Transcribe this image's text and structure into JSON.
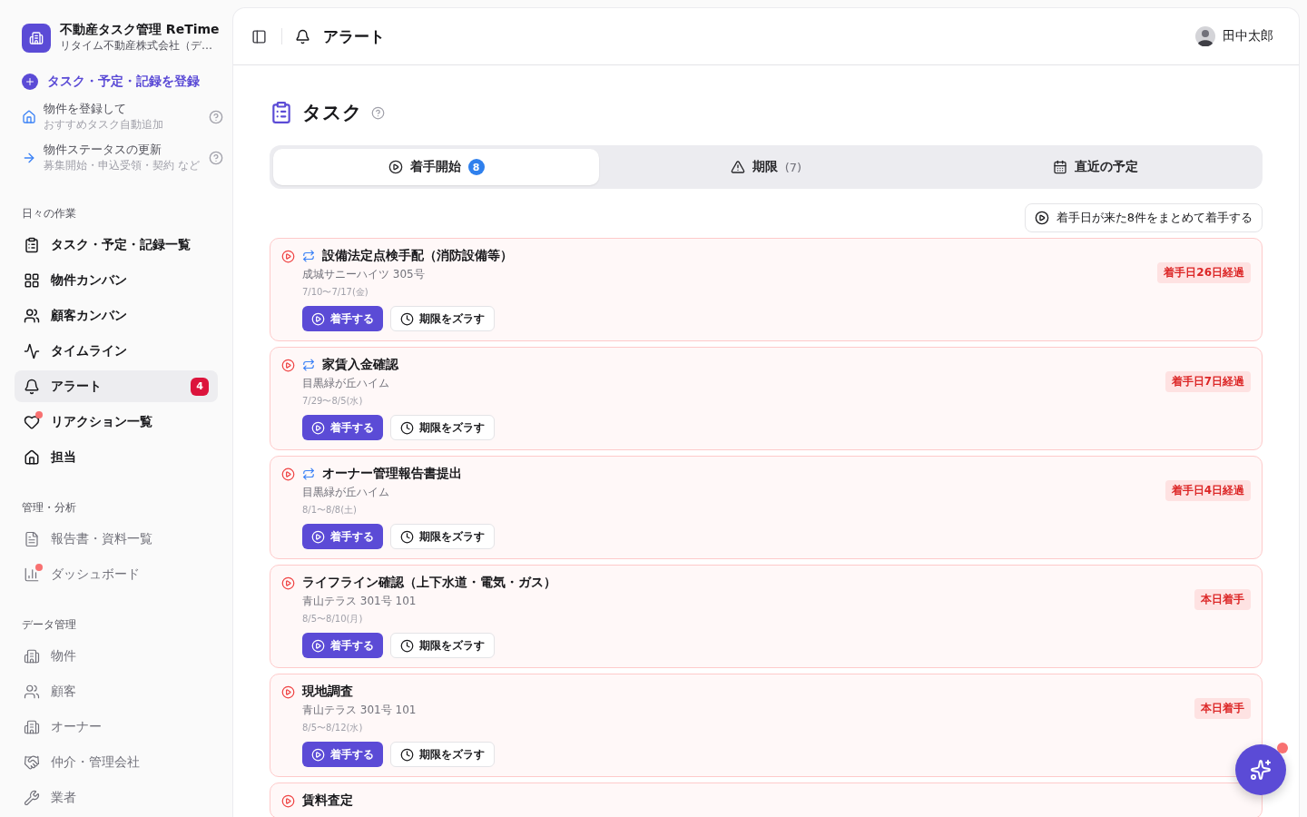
{
  "app": {
    "title": "不動産タスク管理 ReTime",
    "company": "リタイム不動産株式会社（デ…"
  },
  "register_link": {
    "label": "タスク・予定・記録を登録"
  },
  "helpers": [
    {
      "title": "物件を登録して",
      "subtitle": "おすすめタスク自動追加"
    },
    {
      "title": "物件ステータスの更新",
      "subtitle": "募集開始・申込受領・契約 など"
    }
  ],
  "sidebar": {
    "sections": [
      {
        "heading": "日々の作業",
        "kind": "primary",
        "items": [
          {
            "label": "タスク・予定・記録一覧",
            "selected": false,
            "dot": false
          },
          {
            "label": "物件カンバン",
            "selected": false,
            "dot": false
          },
          {
            "label": "顧客カンバン",
            "selected": false,
            "dot": false
          },
          {
            "label": "タイムライン",
            "selected": false,
            "dot": false
          },
          {
            "label": "アラート",
            "selected": true,
            "dot": false,
            "badge": "4"
          },
          {
            "label": "リアクション一覧",
            "selected": false,
            "dot": true
          },
          {
            "label": "担当",
            "selected": false,
            "dot": false
          }
        ]
      },
      {
        "heading": "管理・分析",
        "kind": "secondary",
        "items": [
          {
            "label": "報告書・資料一覧",
            "selected": false,
            "dot": false
          },
          {
            "label": "ダッシュボード",
            "selected": false,
            "dot": true
          }
        ]
      },
      {
        "heading": "データ管理",
        "kind": "secondary",
        "items": [
          {
            "label": "物件",
            "selected": false,
            "dot": false
          },
          {
            "label": "顧客",
            "selected": false,
            "dot": false
          },
          {
            "label": "オーナー",
            "selected": false,
            "dot": false
          },
          {
            "label": "仲介・管理会社",
            "selected": false,
            "dot": false
          },
          {
            "label": "業者",
            "selected": false,
            "dot": false
          }
        ]
      }
    ]
  },
  "header": {
    "title": "アラート",
    "user": "田中太郎"
  },
  "page": {
    "title": "タスク"
  },
  "tabs": [
    {
      "label": "着手開始",
      "count": "8",
      "selected": true
    },
    {
      "label": "期限",
      "count": "(7)",
      "selected": false
    },
    {
      "label": "直近の予定",
      "selected": false
    }
  ],
  "bulk_button": "着手日が来た8件をまとめて着手する",
  "tasks": [
    {
      "title": "設備法定点検手配（消防設備等）",
      "recurring": true,
      "property": "成城サニーハイツ 305号",
      "dates": "7/10〜7/17(金)",
      "status": "着手日26日経過",
      "start_label": "着手する",
      "postpone_label": "期限をズラす"
    },
    {
      "title": "家賃入金確認",
      "recurring": true,
      "property": "目黒緑が丘ハイム",
      "dates": "7/29〜8/5(水)",
      "status": "着手日7日経過",
      "start_label": "着手する",
      "postpone_label": "期限をズラす"
    },
    {
      "title": "オーナー管理報告書提出",
      "recurring": true,
      "property": "目黒緑が丘ハイム",
      "dates": "8/1〜8/8(土)",
      "status": "着手日4日経過",
      "start_label": "着手する",
      "postpone_label": "期限をズラす"
    },
    {
      "title": "ライフライン確認（上下水道・電気・ガス）",
      "recurring": false,
      "property": "青山テラス 301号 101",
      "dates": "8/5〜8/10(月)",
      "status": "本日着手",
      "start_label": "着手する",
      "postpone_label": "期限をズラす"
    },
    {
      "title": "現地調査",
      "recurring": false,
      "property": "青山テラス 301号 101",
      "dates": "8/5〜8/12(水)",
      "status": "本日着手",
      "start_label": "着手する",
      "postpone_label": "期限をズラす"
    },
    {
      "title": "賃料査定"
    }
  ]
}
